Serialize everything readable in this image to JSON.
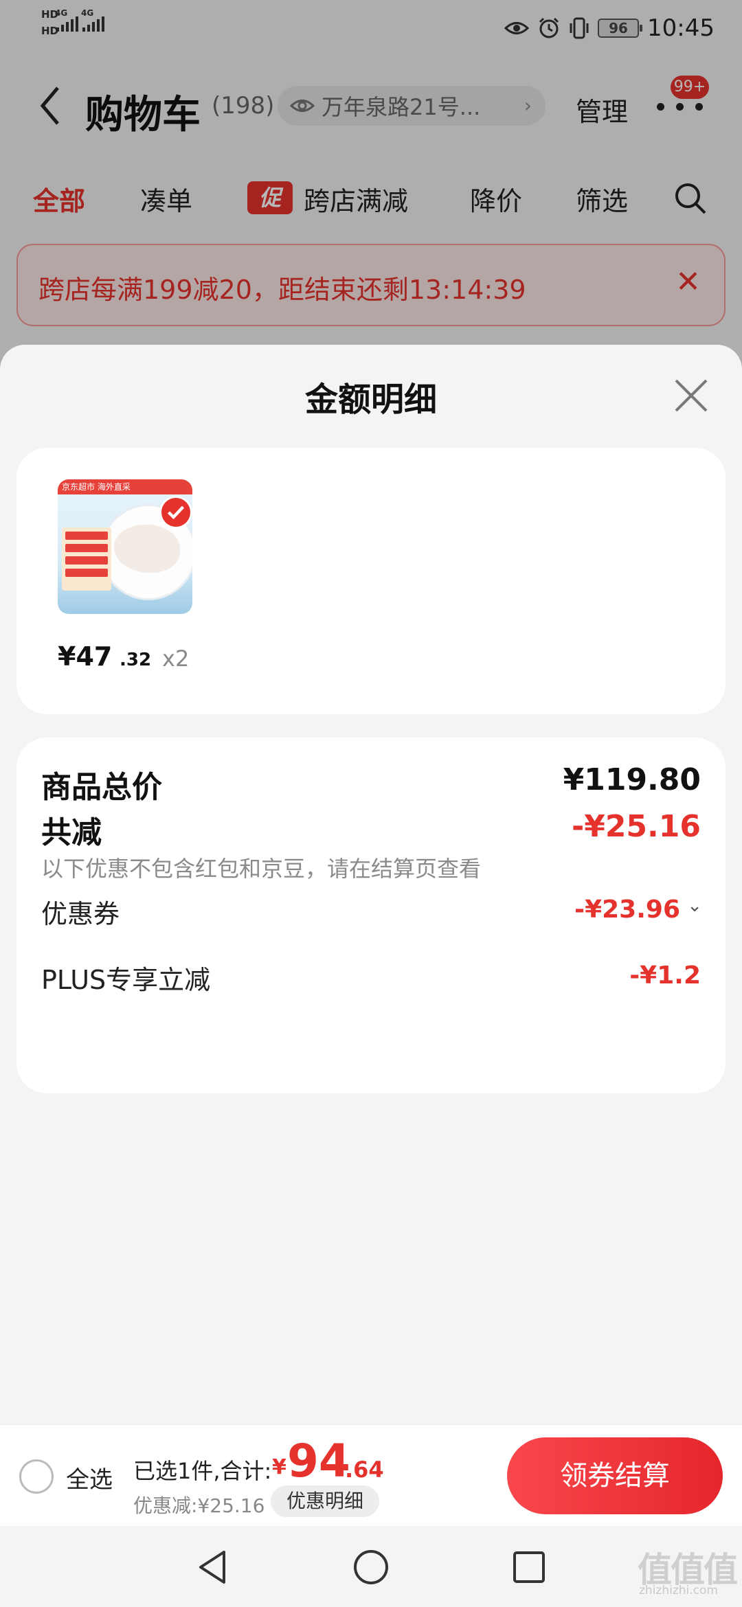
{
  "status_bar": {
    "time": "10:45",
    "battery": "96",
    "sim1": "HD",
    "sim2": "HD",
    "net1": "4G",
    "net2": "4G"
  },
  "header": {
    "title": "购物车",
    "count": "(198)",
    "address": "万年泉路21号...",
    "manage": "管理",
    "badge": "99+"
  },
  "tabs": [
    {
      "label": "全部",
      "active": true
    },
    {
      "label": "凑单",
      "active": false
    },
    {
      "label": "跨店满减",
      "active": false,
      "tag": "促"
    },
    {
      "label": "降价",
      "active": false
    },
    {
      "label": "筛选",
      "active": false
    }
  ],
  "promo_banner": {
    "text": "跨店每满199减20，距结束还剩13:14:39"
  },
  "sheet": {
    "title": "金额明细",
    "product": {
      "price_int": "¥47",
      "price_dec": ".32",
      "quantity": "x2",
      "thumb_banner": "京东超市 海外直采"
    },
    "summary": {
      "total_label": "商品总价",
      "total_value": "¥119.80",
      "reduce_label": "共减",
      "reduce_value": "-¥25.16",
      "note": "以下优惠不包含红包和京豆，请在结算页查看",
      "coupon_label": "优惠券",
      "coupon_value": "-¥23.96",
      "plus_label": "PLUS专享立减",
      "plus_value": "-¥1.2"
    }
  },
  "bottom_bar": {
    "select_all": "全选",
    "selected_text": "已选1件,合计:",
    "currency": "¥",
    "total_int": "94",
    "total_dec": ".64",
    "discount_text": "优惠减:¥25.16",
    "detail_chip": "优惠明细",
    "checkout": "领券结算"
  },
  "watermark": {
    "logo": "值值值",
    "site": "zhizhizhi.com"
  },
  "colors": {
    "accent": "#e5322d",
    "sheet_bg": "#f4f4f4",
    "card_bg": "#ffffff"
  }
}
